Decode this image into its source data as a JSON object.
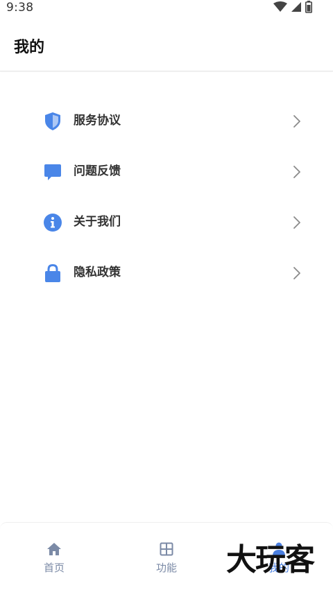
{
  "status_bar": {
    "time": "9:38",
    "icons": [
      "wifi-icon",
      "cell-signal-icon",
      "battery-icon"
    ]
  },
  "header": {
    "title": "我的"
  },
  "menu": {
    "items": [
      {
        "label": "服务协议",
        "icon": "shield-icon"
      },
      {
        "label": "问题反馈",
        "icon": "chat-bubble-icon"
      },
      {
        "label": "关于我们",
        "icon": "info-icon"
      },
      {
        "label": "隐私政策",
        "icon": "lock-icon"
      }
    ]
  },
  "bottom_nav": {
    "items": [
      {
        "label": "首页",
        "icon": "home-icon",
        "active": false
      },
      {
        "label": "功能",
        "icon": "grid-icon",
        "active": false
      },
      {
        "label": "我的",
        "icon": "user-icon",
        "active": true
      }
    ]
  },
  "watermark": "大玩客",
  "colors": {
    "accent": "#4a7fe0",
    "icon_blue": "#4a86e8",
    "nav_inactive": "#7b8aa6",
    "divider": "#e6e6e6"
  }
}
